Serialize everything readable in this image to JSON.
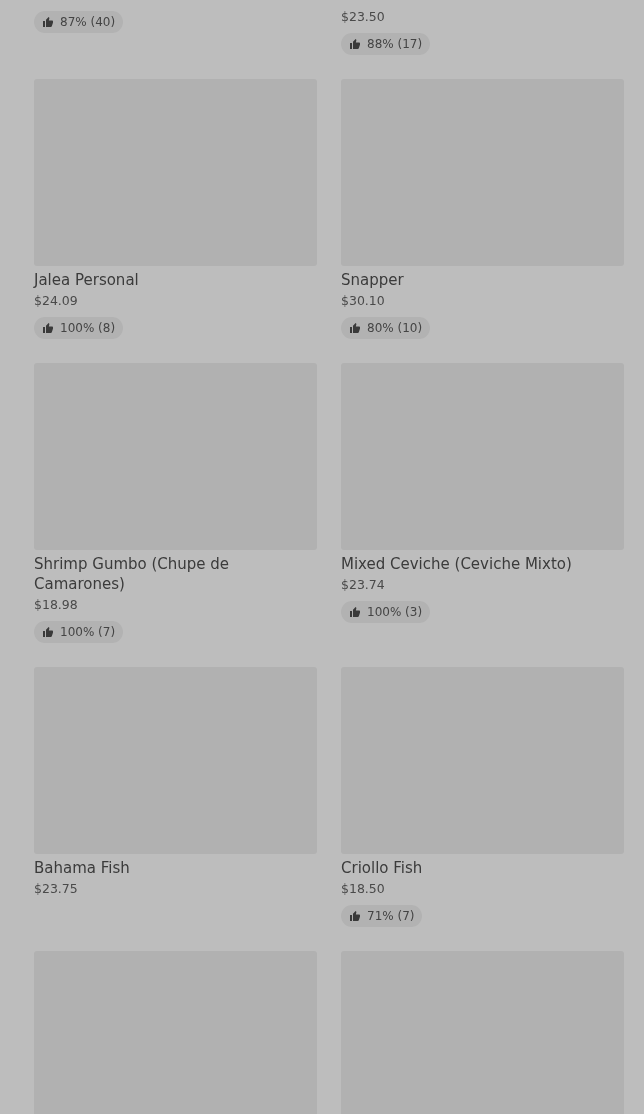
{
  "items": [
    {
      "rating": "87% (40)"
    },
    {
      "price": "$23.50",
      "rating": "88% (17)"
    },
    {
      "name": "Jalea Personal",
      "price": "$24.09",
      "rating": "100% (8)",
      "image": true
    },
    {
      "name": "Snapper",
      "price": "$30.10",
      "rating": "80% (10)",
      "image": true
    },
    {
      "name": "Shrimp Gumbo (Chupe de Camarones)",
      "price": "$18.98",
      "rating": "100% (7)",
      "image": true
    },
    {
      "name": "Mixed Ceviche (Ceviche Mixto)",
      "price": "$23.74",
      "rating": "100% (3)",
      "image": true
    },
    {
      "name": "Bahama Fish",
      "price": "$23.75",
      "image": true
    },
    {
      "name": "Criollo Fish",
      "price": "$18.50",
      "rating": "71% (7)",
      "image": true
    },
    {
      "image": true
    },
    {
      "image": true
    }
  ]
}
